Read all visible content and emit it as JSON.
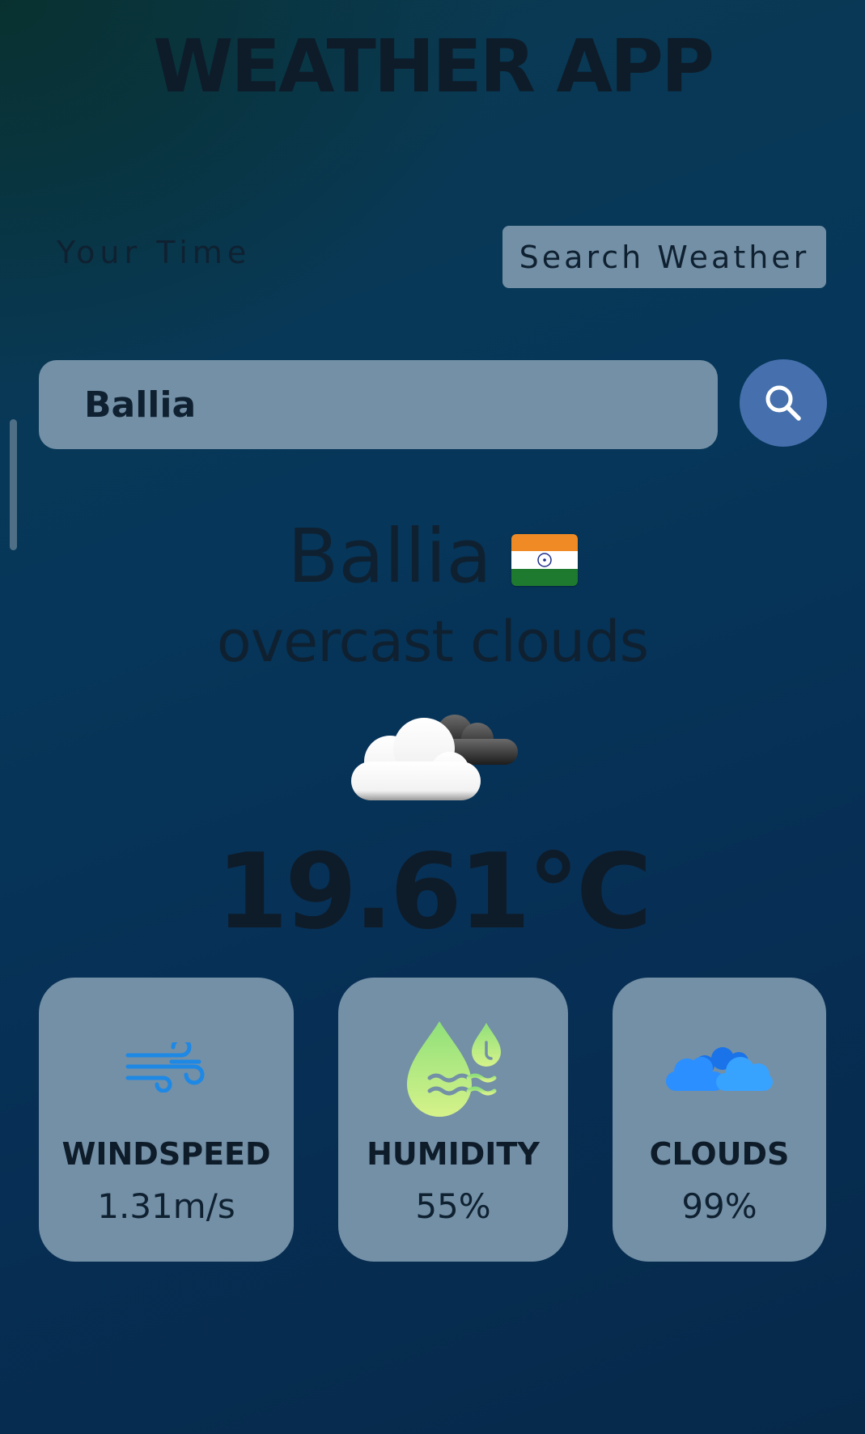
{
  "app": {
    "title": "WEATHER APP"
  },
  "header": {
    "your_time_label": "Your Time",
    "search_weather_label": "Search Weather"
  },
  "search": {
    "value": "Ballia",
    "button_icon": "search-icon"
  },
  "weather": {
    "city": "Ballia",
    "country_flag": "india-flag-icon",
    "description": "overcast clouds",
    "icon": "overcast-clouds-icon",
    "temperature": "19.61°C"
  },
  "stats": {
    "windspeed": {
      "label": "WINDSPEED",
      "value": "1.31m/s",
      "icon": "wind-icon"
    },
    "humidity": {
      "label": "HUMIDITY",
      "value": "55%",
      "icon": "humidity-drops-icon"
    },
    "clouds": {
      "label": "CLOUDS",
      "value": "99%",
      "icon": "clouds-icon"
    }
  },
  "colors": {
    "panel": "#7390a6",
    "search_button": "#4570ad",
    "text_dark": "#0e1c2a"
  }
}
